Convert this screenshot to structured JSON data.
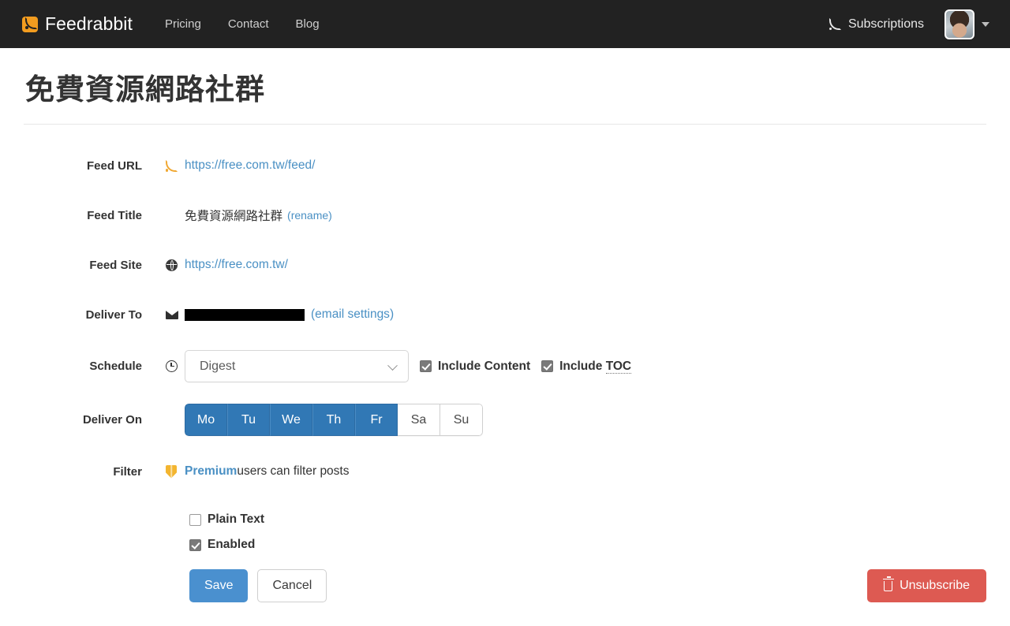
{
  "navbar": {
    "brand": "Feedrabbit",
    "brand_icon": "rss-icon",
    "links": [
      {
        "label": "Pricing"
      },
      {
        "label": "Contact"
      },
      {
        "label": "Blog"
      }
    ],
    "subscriptions_label": "Subscriptions",
    "subscriptions_icon": "rss-icon",
    "avatar_icon": "user-avatar",
    "caret_icon": "chevron-down-icon",
    "background_color": "#222222"
  },
  "page": {
    "title": "免費資源網路社群"
  },
  "form": {
    "feed_url": {
      "label": "Feed URL",
      "icon": "rss-icon",
      "value": "https://free.com.tw/feed/"
    },
    "feed_title": {
      "label": "Feed Title",
      "value": "免費資源網路社群",
      "rename_open": "(",
      "rename_label": "rename",
      "rename_close": ")"
    },
    "feed_site": {
      "label": "Feed Site",
      "icon": "globe-icon",
      "value": "https://free.com.tw/"
    },
    "deliver_to": {
      "label": "Deliver To",
      "icon": "envelope-icon",
      "email": "",
      "email_redacted": true,
      "settings_open": "(",
      "settings_label": "email settings",
      "settings_close": ")"
    },
    "schedule": {
      "label": "Schedule",
      "icon": "clock-icon",
      "selected": "Digest",
      "options": [
        "Digest"
      ],
      "include_content": {
        "label": "Include Content",
        "checked": true
      },
      "include_toc": {
        "label_prefix": "Include ",
        "abbr": "TOC",
        "checked": true
      }
    },
    "deliver_on": {
      "label": "Deliver On",
      "days": [
        {
          "label": "Mo",
          "selected": true
        },
        {
          "label": "Tu",
          "selected": true
        },
        {
          "label": "We",
          "selected": true
        },
        {
          "label": "Th",
          "selected": true
        },
        {
          "label": "Fr",
          "selected": true
        },
        {
          "label": "Sa",
          "selected": false
        },
        {
          "label": "Su",
          "selected": false
        }
      ]
    },
    "filter": {
      "label": "Filter",
      "icon": "shield-icon",
      "premium_label": "Premium",
      "text": " users can filter posts"
    },
    "plain_text": {
      "label": "Plain Text",
      "checked": false
    },
    "enabled": {
      "label": "Enabled",
      "checked": true
    }
  },
  "actions": {
    "save_label": "Save",
    "cancel_label": "Cancel",
    "unsubscribe_label": "Unsubscribe",
    "unsubscribe_icon": "trash-icon"
  },
  "colors": {
    "navbar_bg": "#222222",
    "brand_orange": "#f29c1f",
    "link_blue": "#4a90c4",
    "day_selected_blue": "#3178b5",
    "primary_blue": "#4a90cf",
    "danger_red": "#dd5a52",
    "premium_yellow": "#f3b530"
  }
}
